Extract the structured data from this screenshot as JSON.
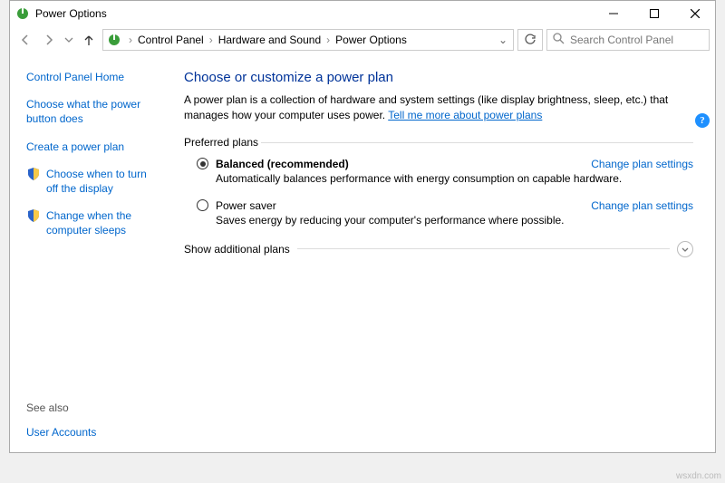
{
  "titlebar": {
    "title": "Power Options"
  },
  "breadcrumbs": {
    "items": [
      "Control Panel",
      "Hardware and Sound",
      "Power Options"
    ]
  },
  "search": {
    "placeholder": "Search Control Panel"
  },
  "sidebar": {
    "home": "Control Panel Home",
    "links": [
      "Choose what the power button does",
      "Create a power plan",
      "Choose when to turn off the display",
      "Change when the computer sleeps"
    ],
    "see_also_label": "See also",
    "see_also_link": "User Accounts"
  },
  "main": {
    "heading": "Choose or customize a power plan",
    "desc_text": "A power plan is a collection of hardware and system settings (like display brightness, sleep, etc.) that manages how your computer uses power. ",
    "desc_link": "Tell me more about power plans",
    "preferred_label": "Preferred plans",
    "plans": [
      {
        "name": "Balanced (recommended)",
        "desc": "Automatically balances performance with energy consumption on capable hardware.",
        "link": "Change plan settings",
        "selected": true
      },
      {
        "name": "Power saver",
        "desc": "Saves energy by reducing your computer's performance where possible.",
        "link": "Change plan settings",
        "selected": false
      }
    ],
    "show_more": "Show additional plans"
  },
  "watermark": "wsxdn.com"
}
